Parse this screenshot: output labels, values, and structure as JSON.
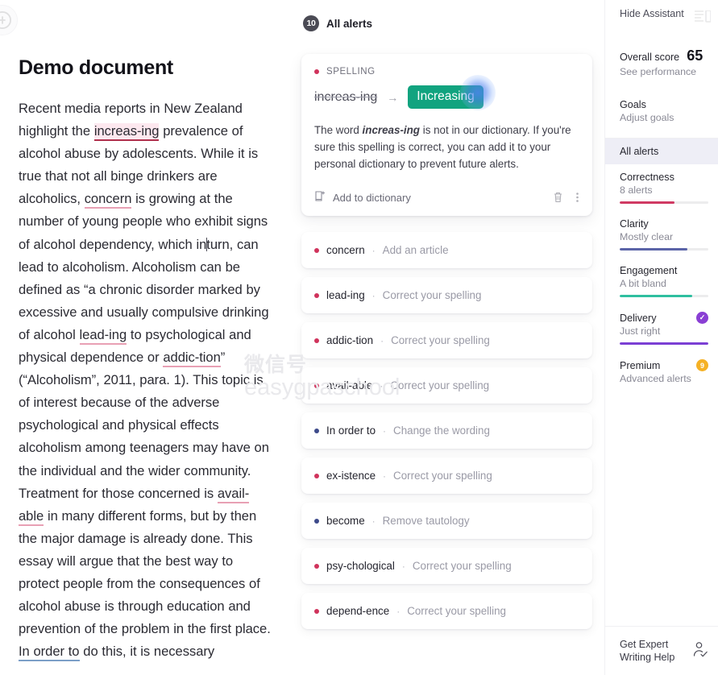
{
  "document": {
    "title": "Demo document",
    "logo_icon": "grammarly-logo-icon",
    "paragraph_parts": {
      "p1": "Recent media reports in New Zealand highlight the ",
      "spell1": "increas-ing",
      "p2": " prevalence of alcohol abuse by adolescents. While it is true that not all binge drinkers are alcoholics, ",
      "spell2": "concern",
      "p3": " is growing at the number of young people who exhibit signs of alcohol dependency, which in",
      "p3b": "turn, can lead to alcoholism. Alcoholism can be defined as “a chronic disorder marked by excessive and usually compulsive drinking of alcohol ",
      "spell3": "lead-ing",
      "p4": " to psychological and physical dependence or ",
      "spell4": "addic-tion",
      "p5": "” (“Alcoholism”, 2011, para. 1). This topic is of interest because of the adverse psychological and physical effects alcoholism among teenagers may have on the individual and the wider community. Treatment for those concerned is ",
      "spell5": "avail-able",
      "p6": " in many different forms, but by then the major damage is already done. This essay will argue that the best way to protect people from the consequences of alcohol abuse is through education and prevention of the problem in the first place. ",
      "clarity1": "In order to",
      "p7": " do this, it is necessary"
    }
  },
  "watermark": {
    "line1": "微信号",
    "line2": "easygpaschool"
  },
  "alerts_header": {
    "count": "10",
    "label": "All alerts"
  },
  "open_card": {
    "category": "SPELLING",
    "original": "increas-ing",
    "arrow": "→",
    "suggestion": "Increasing",
    "desc_pre": "The word ",
    "desc_bold": "increas-ing",
    "desc_post": " is not in our dictionary. If you're sure this spelling is correct, you can add it to your personal dictionary to prevent future alerts.",
    "add_to_dictionary": "Add to dictionary",
    "add_icon": "add-to-dictionary-icon",
    "delete_icon": "trash-icon",
    "more_icon": "more-options-icon",
    "accent_color": "#11a37f",
    "dot_color": "#d0335c"
  },
  "alert_rows": [
    {
      "word": "concern",
      "action": "Add an article",
      "type": "red"
    },
    {
      "word": "lead-ing",
      "action": "Correct your spelling",
      "type": "red"
    },
    {
      "word": "addic-tion",
      "action": "Correct your spelling",
      "type": "red"
    },
    {
      "word": "avail-able",
      "action": "Correct your spelling",
      "type": "red"
    },
    {
      "word": "In order to",
      "action": "Change the wording",
      "type": "blue"
    },
    {
      "word": "ex-istence",
      "action": "Correct your spelling",
      "type": "red"
    },
    {
      "word": "become",
      "action": "Remove tautology",
      "type": "blue"
    },
    {
      "word": "psy-chological",
      "action": "Correct your spelling",
      "type": "red"
    },
    {
      "word": "depend-ence",
      "action": "Correct your spelling",
      "type": "red"
    }
  ],
  "sidebar": {
    "hide_assistant": "Hide Assistant",
    "panel_icon": "collapse-panel-icon",
    "overall_score_label": "Overall score",
    "overall_score_value": "65",
    "see_performance": "See performance",
    "goals_label": "Goals",
    "adjust_goals": "Adjust goals",
    "all_alerts": "All alerts",
    "metrics": [
      {
        "title": "Correctness",
        "sub": "8 alerts",
        "fill": 62,
        "color": "#d03a63",
        "badge": null
      },
      {
        "title": "Clarity",
        "sub": "Mostly clear",
        "fill": 76,
        "color": "#5b64a8",
        "badge": null
      },
      {
        "title": "Engagement",
        "sub": "A bit bland",
        "fill": 82,
        "color": "#2fbfa0",
        "badge": null
      },
      {
        "title": "Delivery",
        "sub": "Just right",
        "fill": 100,
        "color": "#7b3fd4",
        "badge": {
          "glyph": "✓",
          "color": "#8a3fd4"
        }
      },
      {
        "title": "Premium",
        "sub": "Advanced alerts",
        "fill": 0,
        "color": "#f0b429",
        "badge": {
          "glyph": "9",
          "color": "#f5b125"
        }
      }
    ],
    "footer_text": "Get Expert Writing Help",
    "footer_icon": "expert-writer-icon"
  }
}
